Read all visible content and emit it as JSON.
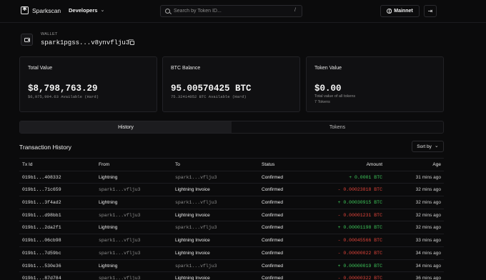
{
  "app": {
    "brand": "Sparkscan",
    "nav_developers": "Developers",
    "search_placeholder": "Search by Token ID...",
    "search_shortcut": "/",
    "network": "Mainnet"
  },
  "wallet": {
    "label": "WALLET",
    "address": "spark1pgss...v8ynvflju3"
  },
  "cards": {
    "total_value": {
      "title": "Total Value",
      "value": "$8,798,763.29",
      "sub": "$6,975,994.63 Available (Hard)"
    },
    "btc_balance": {
      "title": "BTC Balance",
      "value": "95.00570425 BTC",
      "sub": "75.32414052 BTC Available (Hard)"
    },
    "token_value": {
      "title": "Token Value",
      "value": "$0.00",
      "sub": "Total value of all tokens",
      "sub2": "7 Tokens"
    }
  },
  "tabs": [
    "History",
    "Tokens"
  ],
  "history": {
    "title": "Transaction History",
    "sort_label": "Sort by",
    "columns": [
      "Tx Id",
      "From",
      "To",
      "Status",
      "Amount",
      "Age"
    ],
    "rows": [
      {
        "tx": "019b1...408332",
        "from": "Lightning",
        "to": "spark1...vflju3",
        "status": "Confirmed",
        "amount": "+ 0.0001 BTC",
        "dir": "pos",
        "age": "31 mins ago"
      },
      {
        "tx": "019b1...71c659",
        "from": "spark1...vflju3",
        "to": "Lightning Invoice",
        "status": "Confirmed",
        "amount": "- 0.00023818 BTC",
        "dir": "neg",
        "age": "32 mins ago"
      },
      {
        "tx": "019b1...3f4ad2",
        "from": "Lightning",
        "to": "spark1...vflju3",
        "status": "Confirmed",
        "amount": "+ 0.00030915 BTC",
        "dir": "pos",
        "age": "32 mins ago"
      },
      {
        "tx": "019b1...d98bb1",
        "from": "spark1...vflju3",
        "to": "Lightning Invoice",
        "status": "Confirmed",
        "amount": "- 0.00001231 BTC",
        "dir": "neg",
        "age": "32 mins ago"
      },
      {
        "tx": "019b1...2da2f1",
        "from": "Lightning",
        "to": "spark1...vflju3",
        "status": "Confirmed",
        "amount": "+ 0.00001198 BTC",
        "dir": "pos",
        "age": "32 mins ago"
      },
      {
        "tx": "019b1...06cb98",
        "from": "spark1...vflju3",
        "to": "Lightning Invoice",
        "status": "Confirmed",
        "amount": "- 0.00045566 BTC",
        "dir": "neg",
        "age": "33 mins ago"
      },
      {
        "tx": "019b1...7d59bc",
        "from": "spark1...vflju3",
        "to": "Lightning Invoice",
        "status": "Confirmed",
        "amount": "- 0.00000022 BTC",
        "dir": "neg",
        "age": "34 mins ago"
      },
      {
        "tx": "019b1...530e36",
        "from": "Lightning",
        "to": "spark1...vflju3",
        "status": "Confirmed",
        "amount": "+ 0.00000019 BTC",
        "dir": "pos",
        "age": "34 mins ago"
      },
      {
        "tx": "019b1...87d784",
        "from": "spark1...vflju3",
        "to": "Lightning Invoice",
        "status": "Confirmed",
        "amount": "- 0.00000322 BTC",
        "dir": "neg",
        "age": "36 mins ago"
      }
    ]
  },
  "colors": {
    "positive": "#3ec75a",
    "negative": "#e0443a",
    "background": "#0b0b0c"
  }
}
